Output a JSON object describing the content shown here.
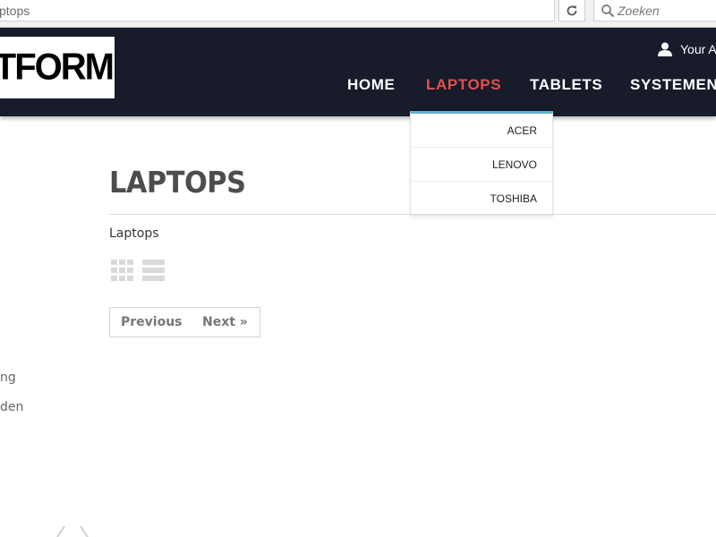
{
  "browser": {
    "url_text": "ptops",
    "search_placeholder": "Zoeken"
  },
  "header": {
    "logo_text": "ATFORM",
    "account_label": "Your A"
  },
  "nav": {
    "items": [
      {
        "label": "HOME",
        "active": false
      },
      {
        "label": "LAPTOPS",
        "active": true
      },
      {
        "label": "TABLETS",
        "active": false
      },
      {
        "label": "SYSTEMEN",
        "active": false
      }
    ]
  },
  "dropdown": {
    "items": [
      "ACER",
      "LENOVO",
      "TOSHIBA"
    ]
  },
  "main": {
    "title": "LAPTOPS",
    "description": "Laptops",
    "pager": {
      "previous_label": "Previous",
      "next_label": "Next »"
    }
  },
  "sidebar": {
    "links": [
      "ng",
      "den"
    ]
  },
  "colors": {
    "header_bg": "#171b2a",
    "nav_active": "#e0504e",
    "dropdown_accent": "#5fb0cf"
  }
}
